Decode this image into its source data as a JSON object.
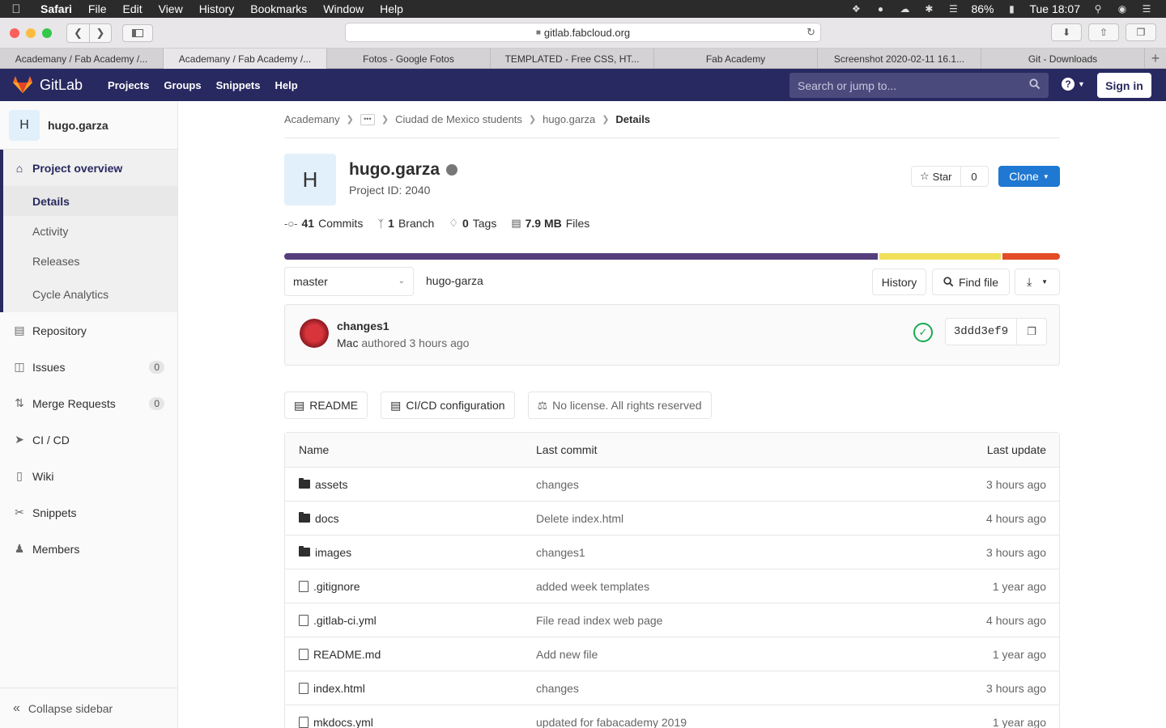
{
  "menubar": {
    "app": "Safari",
    "items": [
      "File",
      "Edit",
      "View",
      "History",
      "Bookmarks",
      "Window",
      "Help"
    ],
    "battery": "86%",
    "clock": "Tue 18:07"
  },
  "browser": {
    "url": "gitlab.fabcloud.org",
    "tabs": [
      "Academany / Fab Academy /...",
      "Academany / Fab Academy /...",
      "Fotos - Google Fotos",
      "TEMPLATED - Free CSS, HT...",
      "Fab Academy",
      "Screenshot 2020-02-11 16.1...",
      "Git - Downloads"
    ],
    "active_tab": 1
  },
  "header": {
    "brand": "GitLab",
    "nav": [
      "Projects",
      "Groups",
      "Snippets",
      "Help"
    ],
    "search_placeholder": "Search or jump to...",
    "sign_in": "Sign in",
    "brand_color": "#292961"
  },
  "sidebar": {
    "project_initial": "H",
    "project_name": "hugo.garza",
    "overview": "Project overview",
    "overview_sub": [
      "Details",
      "Activity",
      "Releases",
      "Cycle Analytics"
    ],
    "items": [
      {
        "label": "Repository",
        "icon": "document-icon"
      },
      {
        "label": "Issues",
        "icon": "issues-icon",
        "badge": "0"
      },
      {
        "label": "Merge Requests",
        "icon": "merge-request-icon",
        "badge": "0"
      },
      {
        "label": "CI / CD",
        "icon": "rocket-icon"
      },
      {
        "label": "Wiki",
        "icon": "book-icon"
      },
      {
        "label": "Snippets",
        "icon": "scissors-icon"
      },
      {
        "label": "Members",
        "icon": "users-icon"
      }
    ],
    "collapse": "Collapse sidebar"
  },
  "breadcrumb": {
    "items": [
      "Academany",
      "Ciudad de Mexico students",
      "hugo.garza"
    ],
    "current": "Details"
  },
  "project": {
    "initial": "H",
    "name": "hugo.garza",
    "id_text": "Project ID: 2040",
    "star_label": "Star",
    "star_count": "0",
    "clone_label": "Clone"
  },
  "stats": {
    "commits_count": "41",
    "commits_label": "Commits",
    "branch_count": "1",
    "branch_label": "Branch",
    "tags_count": "0",
    "tags_label": "Tags",
    "files_size": "7.9 MB",
    "files_label": "Files"
  },
  "language_bar": [
    {
      "fraction": 0.768,
      "color": "#563d7c"
    },
    {
      "fraction": 0.158,
      "color": "#f1e05a"
    },
    {
      "fraction": 0.074,
      "color": "#e34c26"
    }
  ],
  "tree": {
    "branch": "master",
    "path": "hugo-garza",
    "history": "History",
    "find_file": "Find file"
  },
  "last_commit": {
    "title": "changes1",
    "author": "Mac",
    "authored": "authored 3 hours ago",
    "sha": "3ddd3ef9"
  },
  "file_buttons": {
    "readme": "README",
    "cicd": "CI/CD configuration",
    "license": "No license. All rights reserved"
  },
  "files": {
    "headers": {
      "name": "Name",
      "commit": "Last commit",
      "update": "Last update"
    },
    "rows": [
      {
        "name": "assets",
        "type": "folder",
        "commit": "changes",
        "update": "3 hours ago"
      },
      {
        "name": "docs",
        "type": "folder",
        "commit": "Delete index.html",
        "update": "4 hours ago"
      },
      {
        "name": "images",
        "type": "folder",
        "commit": "changes1",
        "update": "3 hours ago"
      },
      {
        "name": ".gitignore",
        "type": "file",
        "commit": "added week templates",
        "update": "1 year ago"
      },
      {
        "name": ".gitlab-ci.yml",
        "type": "file",
        "commit": "File read index web page",
        "update": "4 hours ago"
      },
      {
        "name": "README.md",
        "type": "file",
        "commit": "Add new file",
        "update": "1 year ago"
      },
      {
        "name": "index.html",
        "type": "file",
        "commit": "changes",
        "update": "3 hours ago"
      },
      {
        "name": "mkdocs.yml",
        "type": "file",
        "commit": "updated for fabacademy 2019",
        "update": "1 year ago"
      }
    ]
  }
}
